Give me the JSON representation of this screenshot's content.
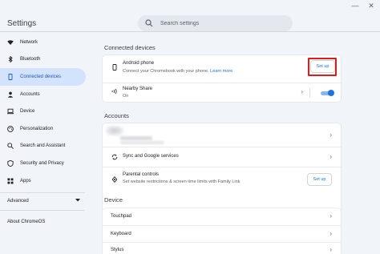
{
  "app": {
    "title": "Settings"
  },
  "search": {
    "placeholder": "Search settings"
  },
  "window_controls": {
    "minimize": "—",
    "close": "✕"
  },
  "sidebar": {
    "items": [
      {
        "label": "Network",
        "icon": "wifi-icon"
      },
      {
        "label": "Bluetooth",
        "icon": "bluetooth-icon"
      },
      {
        "label": "Connected devices",
        "icon": "phone-icon",
        "active": true
      },
      {
        "label": "Accounts",
        "icon": "person-icon"
      },
      {
        "label": "Device",
        "icon": "laptop-icon"
      },
      {
        "label": "Personalization",
        "icon": "palette-icon"
      },
      {
        "label": "Search and Assistant",
        "icon": "search-icon"
      },
      {
        "label": "Security and Privacy",
        "icon": "shield-icon"
      },
      {
        "label": "Apps",
        "icon": "apps-grid-icon"
      }
    ],
    "advanced_label": "Advanced",
    "about_label": "About ChromeOS"
  },
  "connected_devices": {
    "title": "Connected devices",
    "android_phone": {
      "title": "Android phone",
      "subtitle": "Connect your Chromebook with your phone.",
      "link": "Learn more",
      "button": "Set up"
    },
    "nearby_share": {
      "title": "Nearby Share",
      "subtitle": "On",
      "enabled": true
    }
  },
  "accounts": {
    "title": "Accounts",
    "sync": {
      "title": "Sync and Google services"
    },
    "parental": {
      "title": "Parental controls",
      "subtitle": "Set website restrictions & screen time limits with Family Link",
      "button": "Set up"
    }
  },
  "device": {
    "title": "Device",
    "items": [
      {
        "label": "Touchpad"
      },
      {
        "label": "Keyboard"
      },
      {
        "label": "Stylus"
      }
    ]
  },
  "colors": {
    "accent": "#1a73e8",
    "active_nav_bg": "#d3e3fd",
    "highlight": "#e01b1b"
  }
}
